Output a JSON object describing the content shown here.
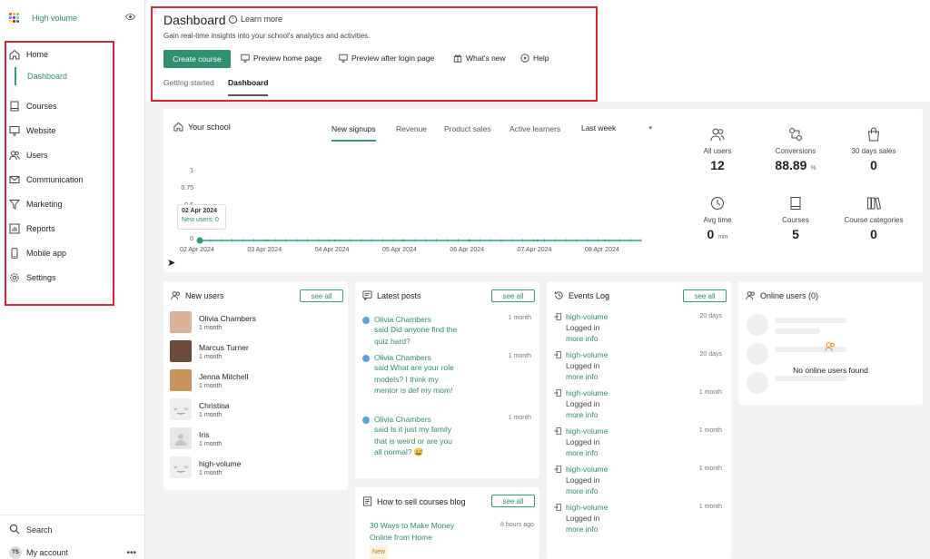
{
  "app": {
    "name": "High volume",
    "brand_color": "#2e8b6f",
    "highlight_color": "#e0242f"
  },
  "sidebar": {
    "items": [
      {
        "label": "Home",
        "icon": "home-icon"
      },
      {
        "label": "Dashboard",
        "icon": ""
      },
      {
        "label": "Courses",
        "icon": "book-icon"
      },
      {
        "label": "Website",
        "icon": "monitor-icon"
      },
      {
        "label": "Users",
        "icon": "users-icon"
      },
      {
        "label": "Communication",
        "icon": "mail-icon"
      },
      {
        "label": "Marketing",
        "icon": "funnel-icon"
      },
      {
        "label": "Reports",
        "icon": "bar-chart-icon"
      },
      {
        "label": "Mobile app",
        "icon": "phone-icon"
      },
      {
        "label": "Settings",
        "icon": "gear-icon"
      }
    ],
    "search_label": "Search",
    "account_label": "My account",
    "account_initials": "TS"
  },
  "header": {
    "title": "Dashboard",
    "learn_more": "Learn more",
    "subtitle": "Gain real-time insights into your school's analytics and activities.",
    "create_course": "Create course",
    "preview_home": "Preview home page",
    "preview_after_login": "Preview after login page",
    "whats_new": "What's new",
    "help": "Help",
    "tabs": [
      "Getting started",
      "Dashboard"
    ]
  },
  "school": {
    "title": "Your school",
    "tabs": [
      "New signups",
      "Revenue",
      "Product sales",
      "Active learners"
    ],
    "period": "Last week",
    "tooltip_date": "02 Apr 2024",
    "tooltip_value": "New users: 0"
  },
  "chart_data": {
    "type": "line",
    "x": [
      "02 Apr 2024",
      "03 Apr 2024",
      "04 Apr 2024",
      "05 Apr 2024",
      "06 Apr 2024",
      "07 Apr 2024",
      "08 Apr 2024"
    ],
    "series": [
      {
        "values": [
          0,
          0,
          0,
          0,
          0,
          0,
          0
        ]
      }
    ],
    "yticks": [
      "1",
      "0.75",
      "0.5",
      "0"
    ],
    "ylim": [
      0,
      1
    ]
  },
  "stats": [
    {
      "label": "All users",
      "value": "12",
      "unit": "",
      "icon": "users-icon"
    },
    {
      "label": "Conversions",
      "value": "88.89",
      "unit": "%",
      "icon": "conversion-icon"
    },
    {
      "label": "30 days sales",
      "value": "0",
      "unit": "",
      "icon": "shopping-bag-icon"
    },
    {
      "label": "Avg time",
      "value": "0",
      "unit": "min",
      "icon": "clock-icon"
    },
    {
      "label": "Courses",
      "value": "5",
      "unit": "",
      "icon": "book-icon"
    },
    {
      "label": "Course categories",
      "value": "0",
      "unit": "",
      "icon": "library-icon"
    }
  ],
  "new_users": {
    "title": "New users",
    "see_all": "see all",
    "users": [
      {
        "name": "Olivia Chambers",
        "time": "1 month"
      },
      {
        "name": "Marcus Turner",
        "time": "1 month"
      },
      {
        "name": "Jenna Mitchell",
        "time": "1 month"
      },
      {
        "name": "Christina",
        "time": "1 month"
      },
      {
        "name": "Iris",
        "time": "1 month"
      },
      {
        "name": "high-volume",
        "time": "1 month"
      }
    ]
  },
  "latest_posts": {
    "title": "Latest posts",
    "see_all": "see all",
    "posts": [
      {
        "name": "Olivia Chambers",
        "text": "said Did anyone find the quiz hard?",
        "time": "1 month"
      },
      {
        "name": "Olivia Chambers",
        "text": "said What are your role models? I think my mentor is def my mom!",
        "time": "1 month"
      },
      {
        "name": "Olivia Chambers",
        "text": "said Is it just my family that is weird or are you all normal? 😅",
        "time": "1 month"
      }
    ]
  },
  "events": {
    "title": "Events Log",
    "see_all": "see all",
    "items": [
      {
        "name": "high-volume",
        "text": "Logged in",
        "more": "more info",
        "time": "20 days"
      },
      {
        "name": "high-volume",
        "text": "Logged in",
        "more": "more info",
        "time": "20 days"
      },
      {
        "name": "high-volume",
        "text": "Logged in",
        "more": "more info",
        "time": "1 month"
      },
      {
        "name": "high-volume",
        "text": "Logged in",
        "more": "more info",
        "time": "1 month"
      },
      {
        "name": "high-volume",
        "text": "Logged in",
        "more": "more info",
        "time": "1 month"
      },
      {
        "name": "high-volume",
        "text": "Logged in",
        "more": "more info",
        "time": "1 month"
      }
    ]
  },
  "online": {
    "title": "Online users (0)",
    "empty": "No online users found"
  },
  "blog": {
    "title": "How to sell courses blog",
    "see_all": "see all",
    "item_title": "30 Ways to Make Money Online from Home",
    "item_time": "8 hours ago",
    "badge": "New"
  }
}
